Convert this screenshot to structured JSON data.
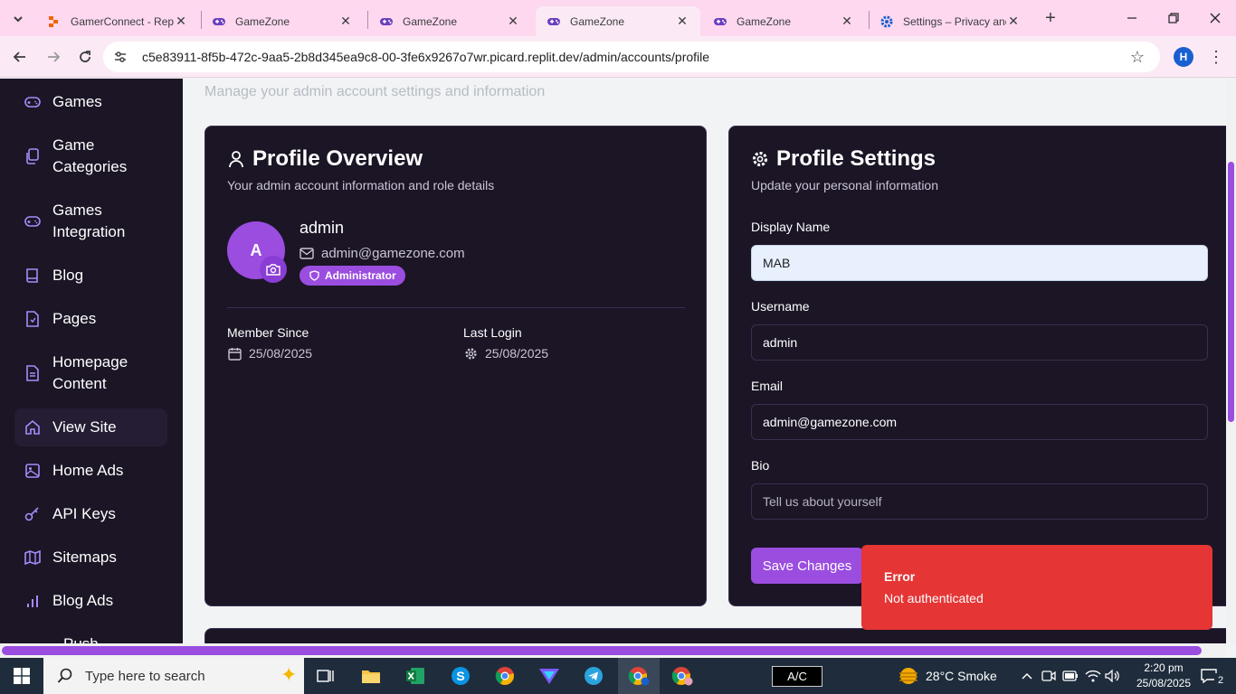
{
  "browser": {
    "tabs": [
      {
        "title": "GamerConnect - Repl",
        "favicon": "replit-icon"
      },
      {
        "title": "GameZone",
        "favicon": "gamepad-icon"
      },
      {
        "title": "GameZone",
        "favicon": "gamepad-icon"
      },
      {
        "title": "GameZone",
        "favicon": "gamepad-icon",
        "active": true
      },
      {
        "title": "GameZone",
        "favicon": "gamepad-icon"
      },
      {
        "title": "Settings – Privacy and",
        "favicon": "gear-icon"
      }
    ],
    "url": "c5e83911-8f5b-472c-9aa5-2b8d345ea9c8-00-3fe6x9267o7wr.picard.replit.dev/admin/accounts/profile",
    "profile_initial": "H"
  },
  "sidebar": {
    "items": [
      {
        "label": "Games",
        "icon": "gamepad-icon"
      },
      {
        "label": "Game Categories",
        "icon": "copy-icon"
      },
      {
        "label": "Games Integration",
        "icon": "gamepad-icon"
      },
      {
        "label": "Blog",
        "icon": "book-icon"
      },
      {
        "label": "Pages",
        "icon": "file-icon"
      },
      {
        "label": "Homepage Content",
        "icon": "document-icon"
      },
      {
        "label": "View Site",
        "icon": "home-icon",
        "selected": true
      },
      {
        "label": "Home Ads",
        "icon": "image-icon"
      },
      {
        "label": "API Keys",
        "icon": "key-icon"
      },
      {
        "label": "Sitemaps",
        "icon": "map-icon"
      },
      {
        "label": "Blog Ads",
        "icon": "bar-chart-icon"
      },
      {
        "label": "Push",
        "icon": "bell-icon"
      }
    ]
  },
  "header": {
    "subtitle": "Manage your admin account settings and information"
  },
  "overview": {
    "title": "Profile Overview",
    "subtitle": "Your admin account information and role details",
    "avatar_initial": "A",
    "name": "admin",
    "email": "admin@gamezone.com",
    "role": "Administrator",
    "member_since_label": "Member Since",
    "member_since": "25/08/2025",
    "last_login_label": "Last Login",
    "last_login": "25/08/2025"
  },
  "settings": {
    "title": "Profile Settings",
    "subtitle": "Update your personal information",
    "display_name_label": "Display Name",
    "display_name": "MAB",
    "username_label": "Username",
    "username": "admin",
    "email_label": "Email",
    "email": "admin@gamezone.com",
    "bio_label": "Bio",
    "bio_placeholder": "Tell us about yourself",
    "save_label": "Save Changes"
  },
  "toast": {
    "title": "Error",
    "message": "Not authenticated"
  },
  "taskbar": {
    "search_placeholder": "Type here to search",
    "ac_label": "A/C",
    "weather": "28°C  Smoke",
    "time": "2:20 pm",
    "date": "25/08/2025",
    "notifications": "2"
  },
  "colors": {
    "accent": "#9b4ddf",
    "sidebar_bg": "#1b1525",
    "toast_bg": "#e53535",
    "tab_strip": "#fdd8ef"
  }
}
